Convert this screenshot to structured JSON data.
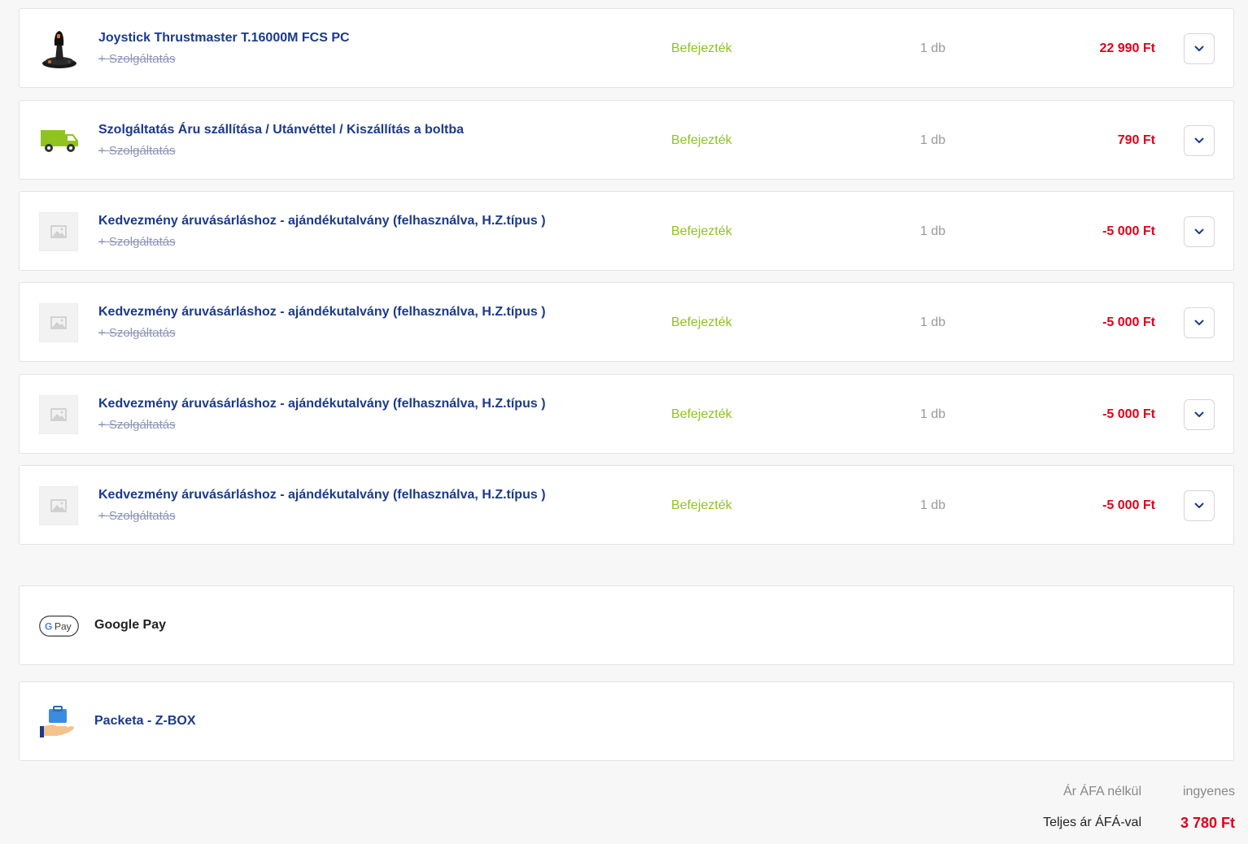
{
  "items": [
    {
      "title": "Joystick Thrustmaster T.16000M FCS PC",
      "service": "+ Szolgáltatás",
      "status": "Befejezték",
      "qty": "1 db",
      "price": "22 990 Ft",
      "icon": "joystick-icon"
    },
    {
      "title": "Szolgáltatás Áru szállítása / Utánvéttel / Kiszállítás a boltba",
      "service": "+ Szolgáltatás",
      "status": "Befejezték",
      "qty": "1 db",
      "price": "790 Ft",
      "icon": "delivery-truck-icon"
    },
    {
      "title": "Kedvezmény áruvásárláshoz - ajándékutalvány (felhasználva, H.Z.típus )",
      "service": "+ Szolgáltatás",
      "status": "Befejezték",
      "qty": "1 db",
      "price": "-5 000 Ft",
      "icon": "image-placeholder-icon"
    },
    {
      "title": "Kedvezmény áruvásárláshoz - ajándékutalvány (felhasználva, H.Z.típus )",
      "service": "+ Szolgáltatás",
      "status": "Befejezték",
      "qty": "1 db",
      "price": "-5 000 Ft",
      "icon": "image-placeholder-icon"
    },
    {
      "title": "Kedvezmény áruvásárláshoz - ajándékutalvány (felhasználva, H.Z.típus )",
      "service": "+ Szolgáltatás",
      "status": "Befejezték",
      "qty": "1 db",
      "price": "-5 000 Ft",
      "icon": "image-placeholder-icon"
    },
    {
      "title": "Kedvezmény áruvásárláshoz - ajándékutalvány (felhasználva, H.Z.típus )",
      "service": "+ Szolgáltatás",
      "status": "Befejezték",
      "qty": "1 db",
      "price": "-5 000 Ft",
      "icon": "image-placeholder-icon"
    }
  ],
  "payment": {
    "label": "Google Pay",
    "badge": "Pay",
    "badge_g": "G"
  },
  "shipping": {
    "label": "Packeta - Z-BOX"
  },
  "summary": {
    "net_label": "Ár ÁFA nélkül",
    "net_value": "ingyenes",
    "total_label": "Teljes ár ÁFÁ-val",
    "total_value": "3 780 Ft"
  },
  "colors": {
    "title": "#1b3a8c",
    "status": "#8fc31f",
    "price": "#e2001a"
  }
}
